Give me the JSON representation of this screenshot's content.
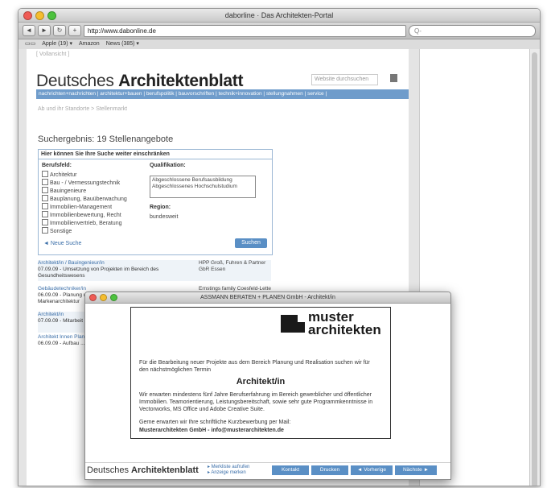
{
  "browser": {
    "title": "daborline · Das Architekten-Portal",
    "url": "http://www.dabonline.de",
    "search_placeholder": "Q-",
    "bookmarks": [
      "Apple (19) ▾",
      "Amazon",
      "News (385) ▾"
    ]
  },
  "page": {
    "top_crumb": "[ Vollansicht ]",
    "logo_light": "Deutsches",
    "logo_bold": "Architektenblatt",
    "site_search_placeholder": "Website durchsuchen",
    "nav": "nachrichten+nachrichten | architektur+bauen | berufspolitik | bauvorschriften | technik+innovation | stellungnahmen | service |",
    "breadcrumb": "Ab und ihr Standorte > Stellenmarkt",
    "result_title": "Suchergebnis: 19 Stellenangebote",
    "filter": {
      "heading": "Hier können Sie Ihre Suche weiter einschränken",
      "berufsfeld_label": "Berufsfeld:",
      "options": [
        "Architektur",
        "Bau - / Vermessungstechnik",
        "Bauingenieure",
        "Bauplanung, Bauüberwachung",
        "Immobilien-Management",
        "Immobilienbewertung, Recht",
        "Immobilienvertrieb, Beratung",
        "Sonstige"
      ],
      "qualifikation_label": "Qualifikation:",
      "qualifikation_options": [
        "Abgeschlossene Berufsausbildung",
        "Abgeschlossenes Hochschulstudium"
      ],
      "region_label": "Region:",
      "region_value": "bundesweit",
      "new_search": "◄ Neue Suche",
      "search_button": "Suchen"
    },
    "listings": [
      {
        "title": "Architekt/in / Bauingenieur/in",
        "text": "07.09.09 - Umsetzung von Projekten im Bereich des Gesundheitswesens",
        "company": "HPP Groß, Fuhren & Partner GbR Essen"
      },
      {
        "title": "Gebäudetechniker/in",
        "text": "06.09.09 - Planung und Auszschrei. Verwalten der Markenarchitektur",
        "company": "Ernstings family Coesfeld-Lette"
      },
      {
        "title": "Architekt/in",
        "text": "07.09.09 - Mitarbeit Projekten",
        "company": ""
      },
      {
        "title": "Architekt Innen Planung",
        "text": "06.09.09 - Aufbau ...",
        "company": ""
      }
    ]
  },
  "popup": {
    "title": "ASSMANN BERATEN + PLANEN GmbH - Architekt/in",
    "logo_line1": "muster",
    "logo_line2": "architekten",
    "intro": "Für die Bearbeitung neuer Projekte aus dem Bereich Planung und Realisation suchen wir für den nächstmöglichen Termin",
    "position": "Architekt/in",
    "body": "Wir erwarten mindestens fünf Jahre Berufserfahrung im Bereich gewerblicher und öffentlicher Immobilien. Teamorientierung, Leistungsbereitschaft, sowie sehr gute Programmkenntnisse in Vectorworks, MS Office und Adobe Creative Suite.",
    "closing": "Gerne erwarten wir Ihre schriftliche Kurzbewerbung per Mail:",
    "contact": "Musterarchitekten GmbH - info@musterarchitekten.de",
    "footer_logo_light": "Deutsches",
    "footer_logo_bold": "Architektenblatt",
    "link1": "▸ Merkliste aufrufen",
    "link2": "▸ Anzeige merken",
    "btn_kontakt": "Kontakt",
    "btn_drucken": "Drucken",
    "btn_vorherige": "◄ Vorherige",
    "btn_naechste": "Nächste ►"
  }
}
